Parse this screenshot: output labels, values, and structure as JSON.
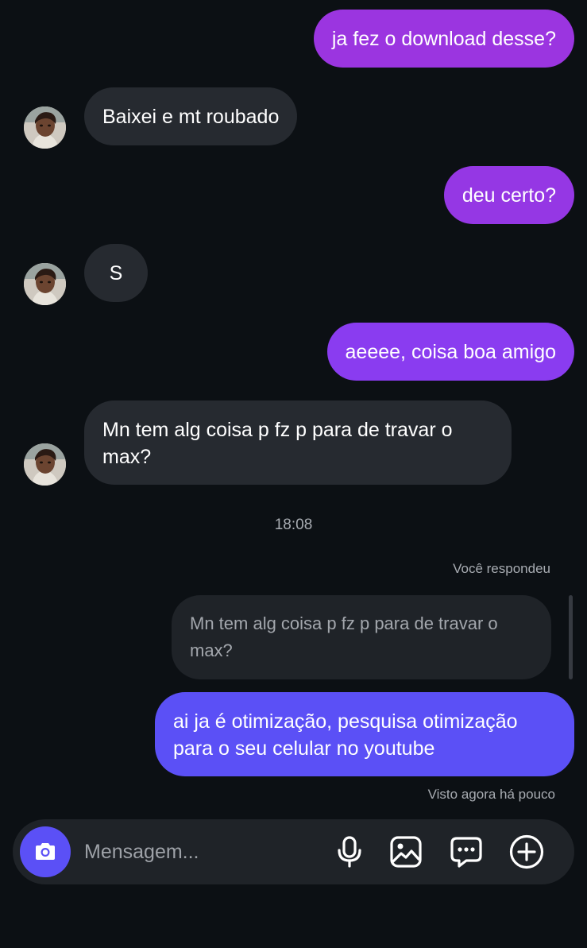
{
  "messages": [
    {
      "text": "ja fez o download desse?"
    },
    {
      "text": "Baixei e mt roubado"
    },
    {
      "text": "deu certo?"
    },
    {
      "text": "S"
    },
    {
      "text": "aeeee, coisa boa amigo"
    },
    {
      "text": "Mn tem alg coisa p fz p para de travar o max?"
    },
    {
      "text": "ai ja é otimização, pesquisa otimização para o seu celular no youtube"
    }
  ],
  "timestamp": "18:08",
  "reply": {
    "label": "Você respondeu",
    "quoted_text": "Mn tem alg coisa p fz p para de travar o max?"
  },
  "seen_status": "Visto agora há pouco",
  "composer": {
    "placeholder": "Mensagem...",
    "icons": [
      "camera-icon",
      "microphone-icon",
      "gallery-icon",
      "sticker-icon",
      "plus-icon"
    ]
  },
  "colors": {
    "background": "#0c1014",
    "incoming_bubble": "#262a30",
    "outgoing_top": "#9b35e0",
    "outgoing_mid": "#8a3cf0",
    "outgoing_bottom": "#5b50f6",
    "camera_button": "#5b50f6"
  }
}
